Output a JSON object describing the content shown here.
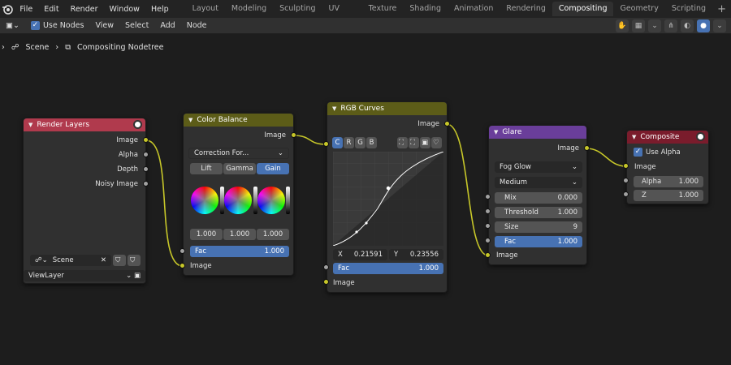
{
  "menu": [
    "File",
    "Edit",
    "Render",
    "Window",
    "Help"
  ],
  "tabs": [
    {
      "label": "Layout",
      "active": false
    },
    {
      "label": "Modeling",
      "active": false
    },
    {
      "label": "Sculpting",
      "active": false
    },
    {
      "label": "UV Editing",
      "active": false
    },
    {
      "label": "Texture Paint",
      "active": false
    },
    {
      "label": "Shading",
      "active": false
    },
    {
      "label": "Animation",
      "active": false
    },
    {
      "label": "Rendering",
      "active": false
    },
    {
      "label": "Compositing",
      "active": true
    },
    {
      "label": "Geometry Nodes",
      "active": false
    },
    {
      "label": "Scripting",
      "active": false
    }
  ],
  "header": {
    "use_nodes": "Use Nodes",
    "view": "View",
    "select": "Select",
    "add": "Add",
    "node": "Node"
  },
  "breadcrumb": {
    "scene": "Scene",
    "tree": "Compositing Nodetree"
  },
  "render_layers": {
    "title": "Render Layers",
    "outputs": [
      "Image",
      "Alpha",
      "Depth",
      "Noisy Image"
    ],
    "scene_value": "Scene",
    "view_layer": "ViewLayer"
  },
  "color_balance": {
    "title": "Color Balance",
    "output": "Image",
    "correction": "Correction For...",
    "modes": [
      "Lift",
      "Gamma",
      "Gain"
    ],
    "values": [
      "1.000",
      "1.000",
      "1.000"
    ],
    "fac_label": "Fac",
    "fac_value": "1.000",
    "input": "Image"
  },
  "rgb_curves": {
    "title": "RGB Curves",
    "output": "Image",
    "channels": [
      "C",
      "R",
      "G",
      "B"
    ],
    "x_label": "X",
    "x_value": "0.21591",
    "y_label": "Y",
    "y_value": "0.23556",
    "fac_label": "Fac",
    "fac_value": "1.000",
    "input": "Image"
  },
  "glare": {
    "title": "Glare",
    "output": "Image",
    "type": "Fog Glow",
    "quality": "Medium",
    "mix_label": "Mix",
    "mix_value": "0.000",
    "threshold_label": "Threshold",
    "threshold_value": "1.000",
    "size_label": "Size",
    "size_value": "9",
    "fac_label": "Fac",
    "fac_value": "1.000",
    "input": "Image"
  },
  "composite": {
    "title": "Composite",
    "use_alpha": "Use Alpha",
    "input": "Image",
    "alpha_label": "Alpha",
    "alpha_value": "1.000",
    "z_label": "Z",
    "z_value": "1.000"
  },
  "colors": {
    "render_layers_header": "#b03a4d",
    "color_balance_header": "#5c5c18",
    "rgb_curves_header": "#5c5c18",
    "glare_header": "#6a3e9a",
    "composite_header": "#7a1c2c",
    "socket_color": "#c7c729",
    "accent": "#4772b3"
  }
}
